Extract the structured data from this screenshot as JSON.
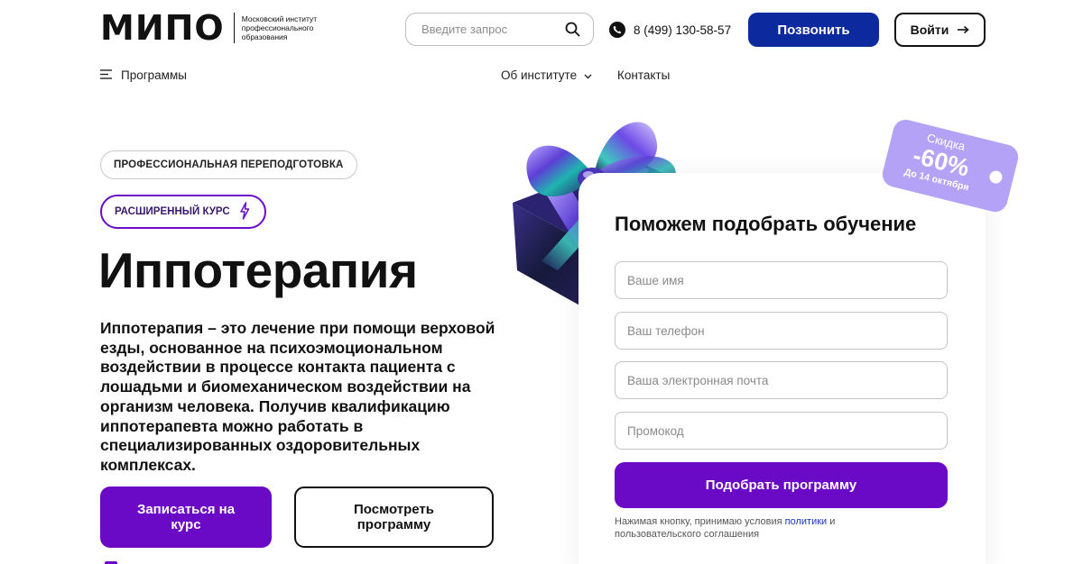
{
  "header": {
    "logo_word": "МИПО",
    "logo_subtitle": "Московский институт профессионального образования",
    "search_placeholder": "Введите запрос",
    "phone": "8 (499) 130-58-57",
    "call_button": "Позвонить",
    "login_button": "Войти"
  },
  "nav": {
    "programs": "Программы",
    "about": "Об институте",
    "contacts": "Контакты"
  },
  "hero": {
    "tag_primary": "ПРОФЕССИОНАЛЬНАЯ ПЕРЕПОДГОТОВКА",
    "tag_secondary": "РАСШИРЕННЫЙ КУРС",
    "title": "Иппотерапия",
    "description": "Иппотерапия – это лечение при помощи верховой езды, основанное на психоэмоциональном воздействии в процессе контакта пациента с лошадьми и биомеханическом воздействии на организм человека. Получив квалификацию иппотерапевта можно работать в специализированных оздоровительных комплексах.",
    "enroll_button": "Записаться на курс",
    "view_button": "Посмотреть программу"
  },
  "form": {
    "title": "Поможем подобрать обучение",
    "name_placeholder": "Ваше имя",
    "phone_placeholder": "Ваш телефон",
    "email_placeholder": "Ваша электронная почта",
    "promo_placeholder": "Промокод",
    "submit_button": "Подобрать программу",
    "consent_prefix": "Нажимая кнопку, принимаю условия ",
    "consent_link": "политики",
    "consent_suffix": " и пользовательского соглашения"
  },
  "promo": {
    "label": "Скидка",
    "value": "-60%",
    "until": "До 14 октября"
  },
  "colors": {
    "brand_blue": "#0c2a9e",
    "accent_purple": "#6b0ac6",
    "ticket_lavender": "#b3a2f5",
    "link_blue": "#1c35b8"
  },
  "icons": {
    "search": "search-icon",
    "phone": "phone-icon",
    "arrow": "arrow-right-icon",
    "menu": "menu-icon",
    "chevron": "chevron-down-icon",
    "lightning": "lightning-icon"
  }
}
